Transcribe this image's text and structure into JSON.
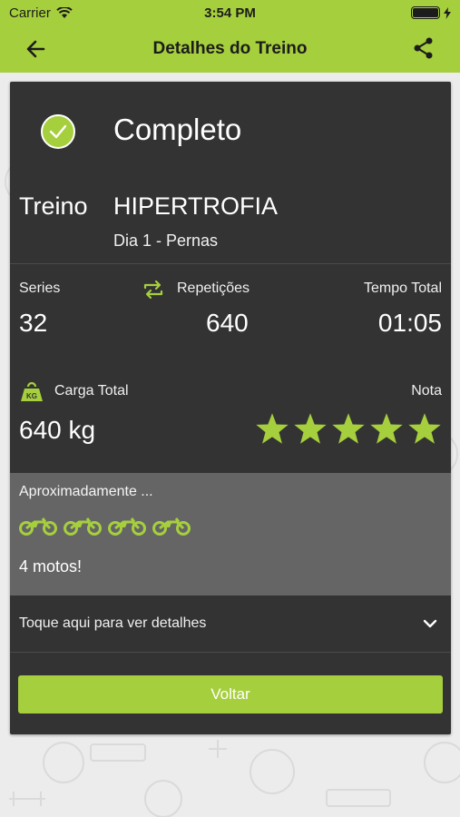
{
  "status_bar": {
    "carrier": "Carrier",
    "time": "3:54 PM"
  },
  "nav": {
    "title": "Detalhes do Treino",
    "back_icon": "arrow-left-icon",
    "share_icon": "share-icon"
  },
  "colors": {
    "accent": "#a6cf3d",
    "card": "#333333",
    "approx_bg": "#656565"
  },
  "workout": {
    "status": "Completo",
    "treino_label": "Treino",
    "name": "HIPERTROFIA",
    "day": "Dia 1 - Pernas"
  },
  "stats": {
    "series_label": "Series",
    "series_value": "32",
    "reps_label": "Repetições",
    "reps_value": "640",
    "time_label": "Tempo Total",
    "time_value": "01:05"
  },
  "load": {
    "label": "Carga Total",
    "value": "640 kg",
    "icon_text": "KG"
  },
  "rating": {
    "label": "Nota",
    "stars": 5
  },
  "approx": {
    "label": "Aproximadamente ...",
    "icon_count": 4,
    "text": "4 motos!"
  },
  "details": {
    "text": "Toque aqui para ver detalhes"
  },
  "actions": {
    "back_button": "Voltar"
  }
}
